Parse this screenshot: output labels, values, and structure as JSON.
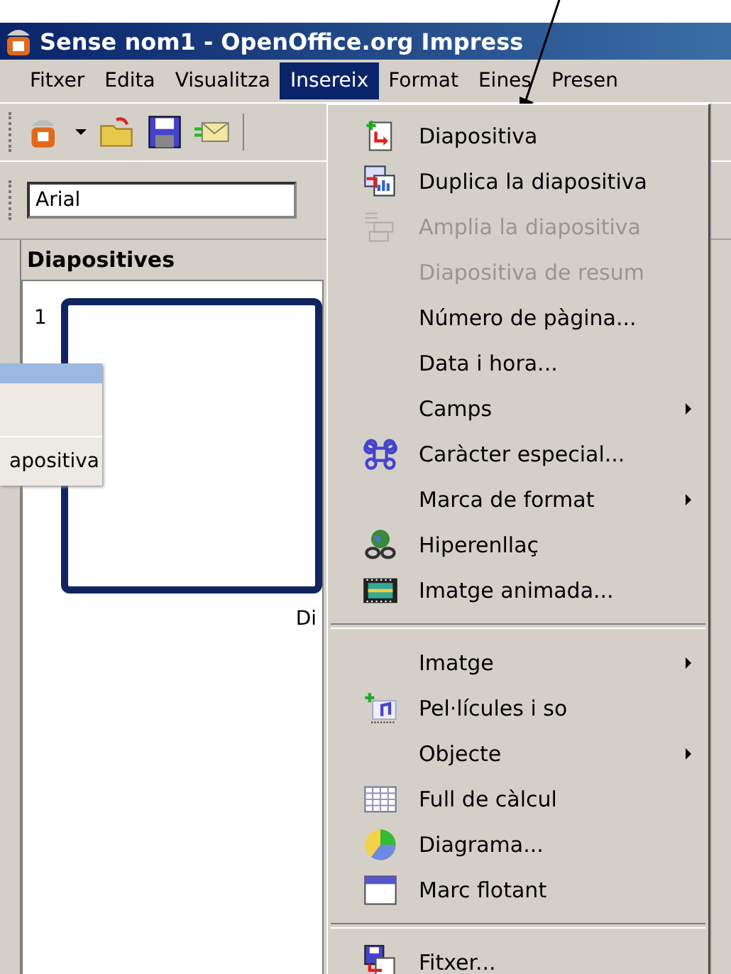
{
  "window": {
    "title": "Sense nom1 - OpenOffice.org Impress"
  },
  "menubar": [
    {
      "label": "Fitxer",
      "selected": false
    },
    {
      "label": "Edita",
      "selected": false
    },
    {
      "label": "Visualitza",
      "selected": false
    },
    {
      "label": "Insereix",
      "selected": true
    },
    {
      "label": "Format",
      "selected": false
    },
    {
      "label": "Eines",
      "selected": false
    },
    {
      "label": "Presen",
      "selected": false
    }
  ],
  "font_field": {
    "value": "Arial"
  },
  "slides_panel": {
    "title": "Diapositives",
    "slides": [
      {
        "number": "1",
        "caption": "Di"
      }
    ]
  },
  "popup_fragment": {
    "label": "apositiva"
  },
  "insert_menu": [
    {
      "kind": "item",
      "label": "Diapositiva",
      "disabled": false,
      "submenu": false
    },
    {
      "kind": "item",
      "label": "Duplica la diapositiva",
      "disabled": false,
      "submenu": false
    },
    {
      "kind": "item",
      "label": "Amplia la diapositiva",
      "disabled": true,
      "submenu": false
    },
    {
      "kind": "item",
      "label": "Diapositiva de resum",
      "disabled": true,
      "submenu": false
    },
    {
      "kind": "item",
      "label": "Número de pàgina...",
      "disabled": false,
      "submenu": false
    },
    {
      "kind": "item",
      "label": "Data i hora...",
      "disabled": false,
      "submenu": false
    },
    {
      "kind": "item",
      "label": "Camps",
      "disabled": false,
      "submenu": true
    },
    {
      "kind": "item",
      "label": "Caràcter especial...",
      "disabled": false,
      "submenu": false
    },
    {
      "kind": "item",
      "label": "Marca de format",
      "disabled": false,
      "submenu": true
    },
    {
      "kind": "item",
      "label": "Hiperenllaç",
      "disabled": false,
      "submenu": false
    },
    {
      "kind": "item",
      "label": "Imatge animada...",
      "disabled": false,
      "submenu": false
    },
    {
      "kind": "separator"
    },
    {
      "kind": "item",
      "label": "Imatge",
      "disabled": false,
      "submenu": true
    },
    {
      "kind": "item",
      "label": "Pel·lícules i so",
      "disabled": false,
      "submenu": false
    },
    {
      "kind": "item",
      "label": "Objecte",
      "disabled": false,
      "submenu": true
    },
    {
      "kind": "item",
      "label": "Full de càlcul",
      "disabled": false,
      "submenu": false
    },
    {
      "kind": "item",
      "label": "Diagrama...",
      "disabled": false,
      "submenu": false
    },
    {
      "kind": "item",
      "label": "Marc flotant",
      "disabled": false,
      "submenu": false
    },
    {
      "kind": "separator"
    },
    {
      "kind": "item",
      "label": "Fitxer...",
      "disabled": false,
      "submenu": false
    }
  ]
}
